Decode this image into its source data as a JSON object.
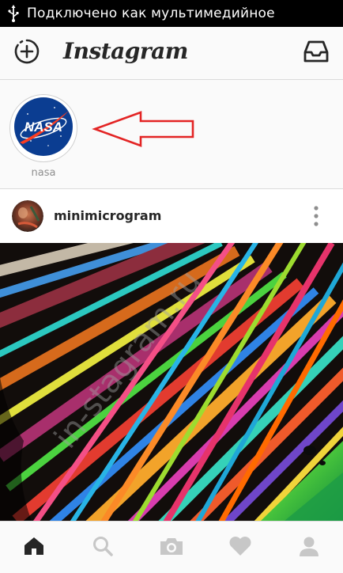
{
  "status_bar": {
    "text": "Подключено как мультимедийное",
    "icon": "usb-icon"
  },
  "header": {
    "logo": "Instagram",
    "left_icon": "add-story-icon",
    "right_icon": "direct-inbox-icon"
  },
  "stories": [
    {
      "label": "nasa",
      "logo_text": "NASA"
    }
  ],
  "post": {
    "username": "minimicrogram"
  },
  "watermark": "in-stagram.ru",
  "tabs": [
    {
      "name": "home",
      "icon": "home-icon",
      "active": true
    },
    {
      "name": "search",
      "icon": "search-icon",
      "active": false
    },
    {
      "name": "camera",
      "icon": "camera-icon",
      "active": false
    },
    {
      "name": "activity",
      "icon": "heart-icon",
      "active": false
    },
    {
      "name": "profile",
      "icon": "profile-icon",
      "active": false
    }
  ],
  "colors": {
    "accent_arrow": "#e32424",
    "text": "#262626",
    "muted": "#8e8e8e"
  }
}
